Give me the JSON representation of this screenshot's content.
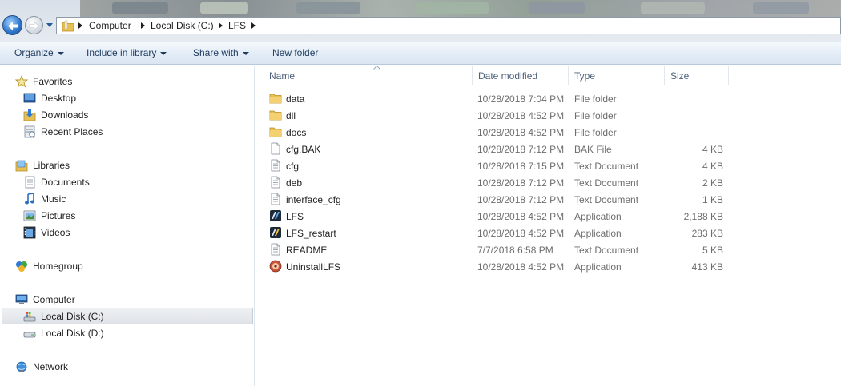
{
  "address": {
    "crumbs": [
      "Computer",
      "Local Disk (C:)",
      "LFS"
    ]
  },
  "toolbar": {
    "organize": "Organize",
    "include_in_library": "Include in library",
    "share_with": "Share with",
    "new_folder": "New folder"
  },
  "nav": {
    "favorites": "Favorites",
    "desktop": "Desktop",
    "downloads": "Downloads",
    "recent_places": "Recent Places",
    "libraries": "Libraries",
    "documents": "Documents",
    "music": "Music",
    "pictures": "Pictures",
    "videos": "Videos",
    "homegroup": "Homegroup",
    "computer": "Computer",
    "local_disk_c": "Local Disk (C:)",
    "local_disk_d": "Local Disk (D:)",
    "network": "Network"
  },
  "columns": {
    "name": "Name",
    "date_modified": "Date modified",
    "type": "Type",
    "size": "Size"
  },
  "files": [
    {
      "name": "data",
      "date": "10/28/2018 7:04 PM",
      "type": "File folder",
      "size": "",
      "icon": "folder-icon"
    },
    {
      "name": "dll",
      "date": "10/28/2018 4:52 PM",
      "type": "File folder",
      "size": "",
      "icon": "folder-icon"
    },
    {
      "name": "docs",
      "date": "10/28/2018 4:52 PM",
      "type": "File folder",
      "size": "",
      "icon": "folder-icon"
    },
    {
      "name": "cfg.BAK",
      "date": "10/28/2018 7:12 PM",
      "type": "BAK File",
      "size": "4 KB",
      "icon": "blank-file-icon"
    },
    {
      "name": "cfg",
      "date": "10/28/2018 7:15 PM",
      "type": "Text Document",
      "size": "4 KB",
      "icon": "text-file-icon"
    },
    {
      "name": "deb",
      "date": "10/28/2018 7:12 PM",
      "type": "Text Document",
      "size": "2 KB",
      "icon": "text-file-icon"
    },
    {
      "name": "interface_cfg",
      "date": "10/28/2018 7:12 PM",
      "type": "Text Document",
      "size": "1 KB",
      "icon": "text-file-icon"
    },
    {
      "name": "LFS",
      "date": "10/28/2018 4:52 PM",
      "type": "Application",
      "size": "2,188 KB",
      "icon": "lfs-app-icon"
    },
    {
      "name": "LFS_restart",
      "date": "10/28/2018 4:52 PM",
      "type": "Application",
      "size": "283 KB",
      "icon": "lfs-restart-app-icon"
    },
    {
      "name": "README",
      "date": "7/7/2018 6:58 PM",
      "type": "Text Document",
      "size": "5 KB",
      "icon": "text-file-icon"
    },
    {
      "name": "UninstallLFS",
      "date": "10/28/2018 4:52 PM",
      "type": "Application",
      "size": "413 KB",
      "icon": "uninstall-app-icon"
    }
  ]
}
